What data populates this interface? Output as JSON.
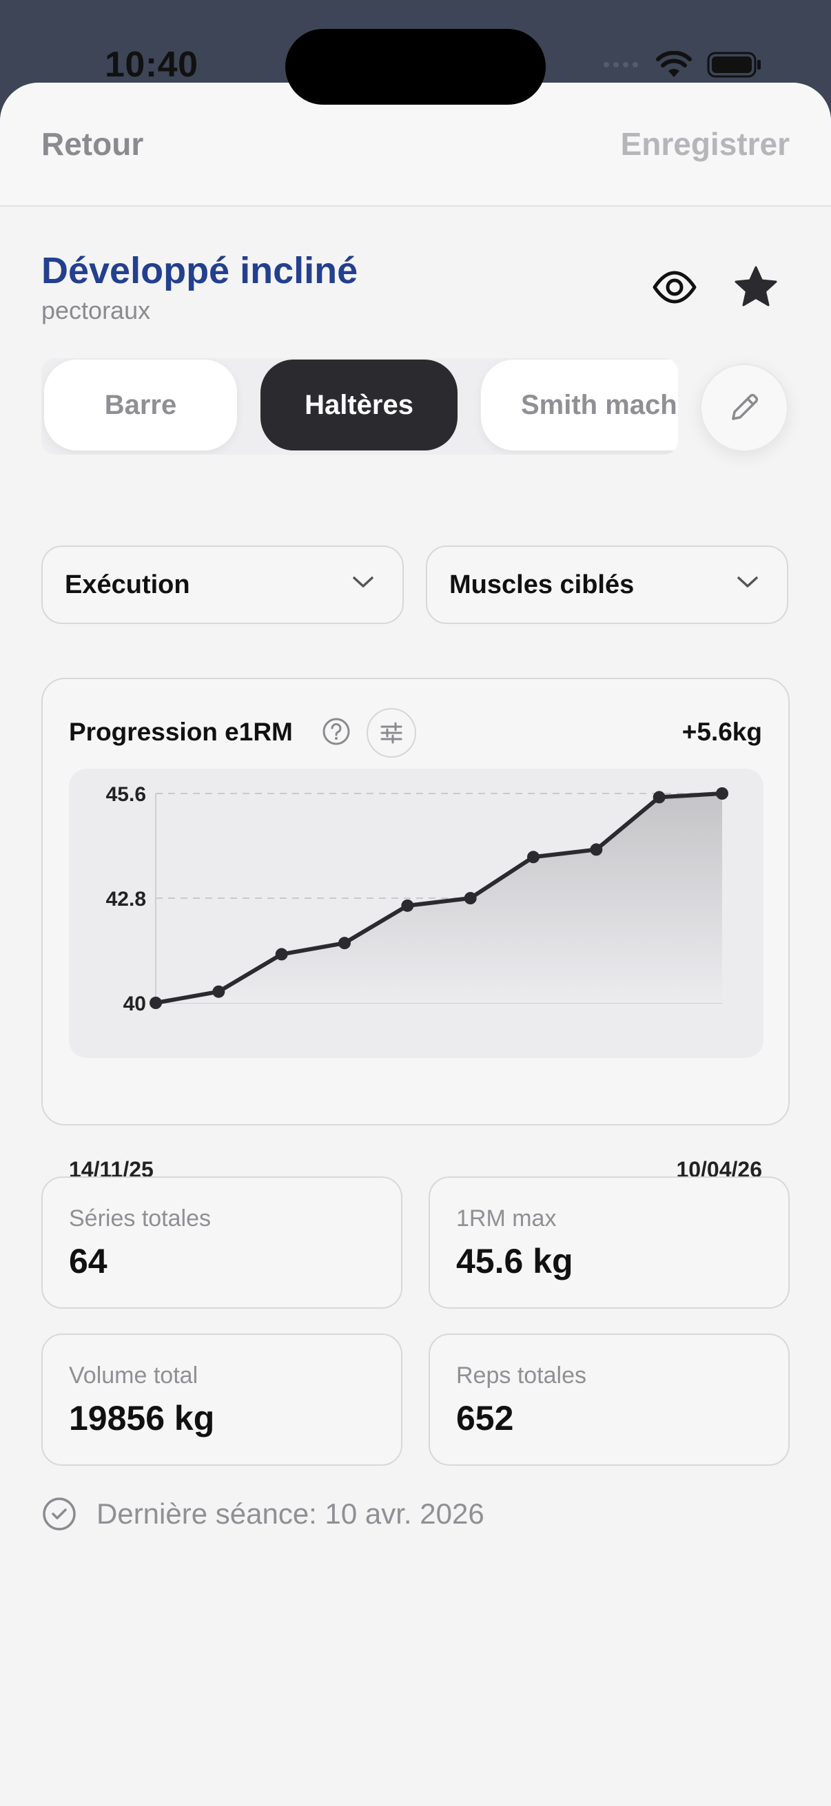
{
  "status": {
    "time": "10:40"
  },
  "nav": {
    "back_label": "Retour",
    "save_label": "Enregistrer"
  },
  "exercise": {
    "title": "Développé incliné",
    "subtitle": "pectoraux"
  },
  "equipment_tabs": [
    {
      "label": "Barre",
      "active": false
    },
    {
      "label": "Haltères",
      "active": true
    },
    {
      "label": "Smith machine",
      "active": false
    }
  ],
  "dropdowns": {
    "execution": "Exécution",
    "muscles": "Muscles ciblés"
  },
  "chart": {
    "title": "Progression e1RM",
    "delta": "+5.6kg",
    "x_start": "14/11/25",
    "x_end": "10/04/26"
  },
  "chart_data": {
    "type": "area",
    "title": "Progression e1RM",
    "xlabel": "",
    "ylabel": "",
    "x": [
      1,
      2,
      3,
      4,
      5,
      6,
      7,
      8,
      9,
      10
    ],
    "values": [
      40.0,
      40.3,
      41.3,
      41.6,
      42.6,
      42.8,
      43.9,
      44.1,
      45.5,
      45.6
    ],
    "y_ticks": [
      40,
      42.8,
      45.6
    ],
    "y_tick_labels": [
      "40",
      "42.8",
      "45.6"
    ],
    "ylim": [
      40,
      45.6
    ],
    "x_range_labels": [
      "14/11/25",
      "10/04/26"
    ],
    "grid": true,
    "colors": {
      "line": "#2b2a2f",
      "fill_top": "#c4c4c7",
      "fill_bottom": "#ececef"
    }
  },
  "stats": {
    "sets": {
      "label": "Séries totales",
      "value": "64"
    },
    "max_1rm": {
      "label": "1RM max",
      "value": "45.6 kg"
    },
    "volume": {
      "label": "Volume total",
      "value": "19856 kg"
    },
    "reps": {
      "label": "Reps totales",
      "value": "652"
    }
  },
  "last_session": "Dernière séance: 10 avr. 2026",
  "icons": [
    "eye-icon",
    "star-icon",
    "pencil-icon",
    "chevron-down-icon",
    "help-icon",
    "sliders-icon",
    "check-circle-icon",
    "wifi-icon",
    "battery-icon",
    "signal-icon"
  ]
}
